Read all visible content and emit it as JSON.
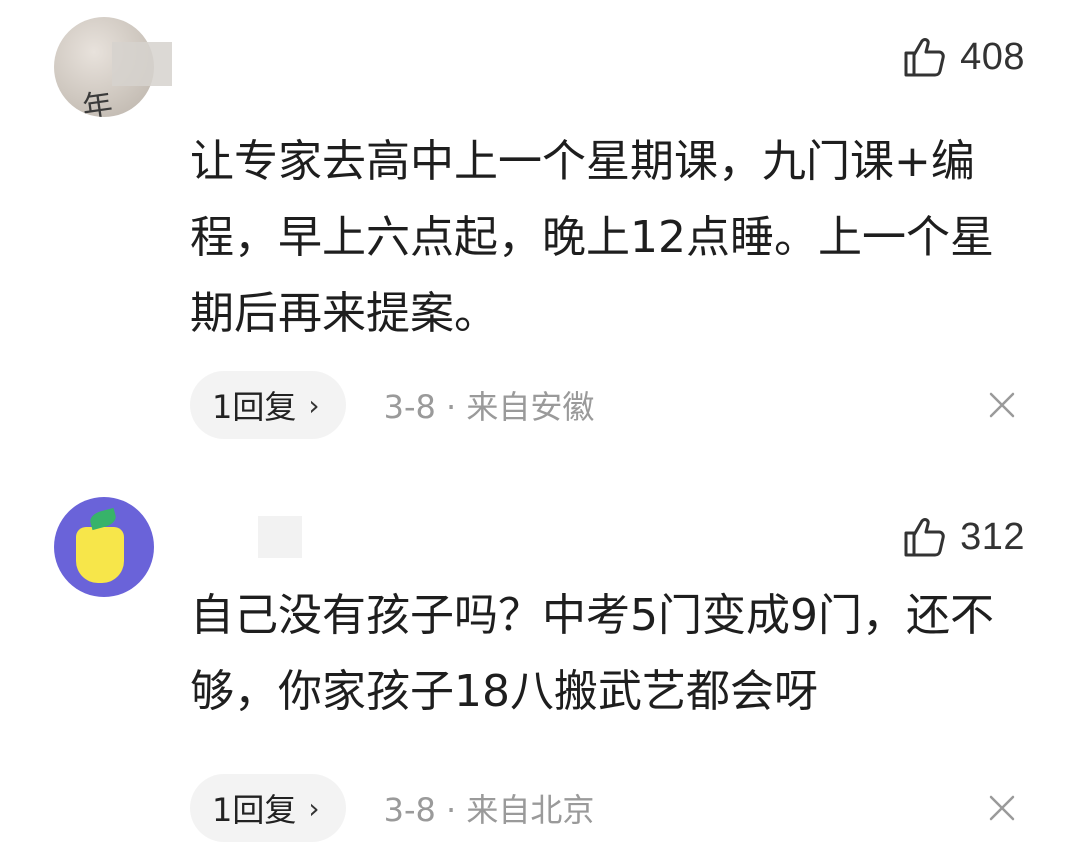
{
  "comments": [
    {
      "likes": "408",
      "text": "让专家去高中上一个星期课，九门课+编程，早上六点起，晚上12点睡。上一个星期后再来提案。",
      "reply_label": "1回复",
      "reply_chevron": "›",
      "meta": "3-8 · 来自安徽",
      "avatar_icon": "user-avatar-icon",
      "like_icon": "thumbs-up-icon",
      "close_icon": "close-icon"
    },
    {
      "likes": "312",
      "text": "自己没有孩子吗？中考5门变成9门，还不够，你家孩子18八搬武艺都会呀",
      "reply_label": "1回复",
      "reply_chevron": "›",
      "meta": "3-8 · 来自北京",
      "avatar_icon": "user-avatar-icon",
      "like_icon": "thumbs-up-icon",
      "close_icon": "close-icon"
    }
  ],
  "colors": {
    "text": "#1e1e1e",
    "meta": "#9a9a9a",
    "pill_bg": "#f3f3f3",
    "icon": "#333333"
  }
}
